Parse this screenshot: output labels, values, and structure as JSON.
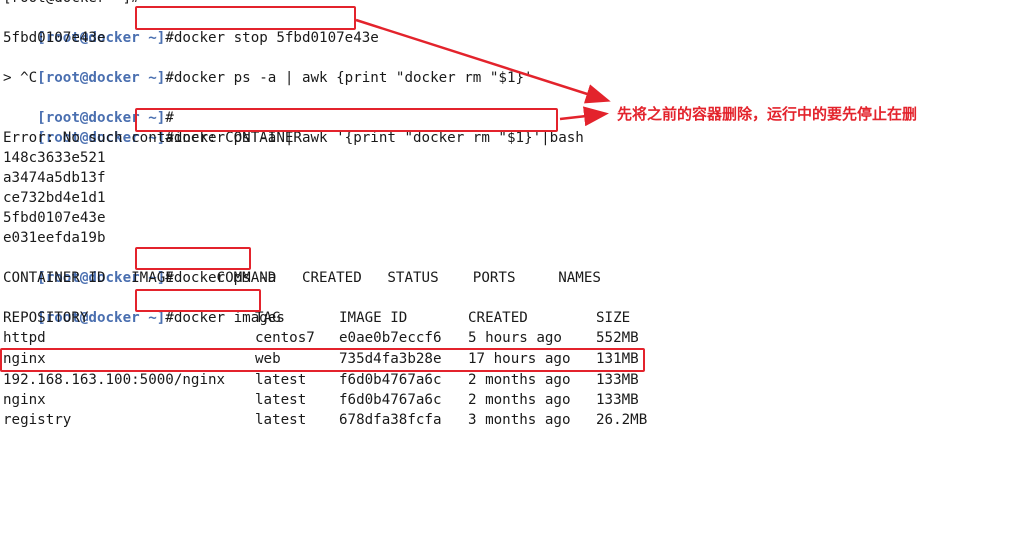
{
  "terminal": {
    "top_cut_fragment": "[root@docker ~]#",
    "lines": [
      {
        "type": "prompt",
        "prompt": "[root@docker ~]",
        "symbol": "#",
        "command": "docker stop 5fbd0107e43e"
      },
      {
        "type": "output",
        "text": "5fbd0107e43e"
      },
      {
        "type": "prompt",
        "prompt": "[root@docker ~]",
        "symbol": "#",
        "command": "docker ps -a | awk {print \"docker rm \"$1}'"
      },
      {
        "type": "output",
        "text": "> ^C"
      },
      {
        "type": "prompt",
        "prompt": "[root@docker ~]",
        "symbol": "#",
        "command": ""
      },
      {
        "type": "prompt",
        "prompt": "[root@docker ~]",
        "symbol": "#",
        "command": "docker ps -a | awk '{print \"docker rm \"$1}'|bash"
      },
      {
        "type": "output",
        "text": "Error: No such container: CONTAINER"
      },
      {
        "type": "output",
        "text": "148c3633e521"
      },
      {
        "type": "output",
        "text": "a3474a5db13f"
      },
      {
        "type": "output",
        "text": "ce732bd4e1d1"
      },
      {
        "type": "output",
        "text": "5fbd0107e43e"
      },
      {
        "type": "output",
        "text": "e031eefda19b"
      },
      {
        "type": "prompt",
        "prompt": "[root@docker ~]",
        "symbol": "#",
        "command": "docker ps -a"
      },
      {
        "type": "output",
        "text": "CONTAINER ID   IMAGE     COMMAND   CREATED   STATUS    PORTS     NAMES"
      },
      {
        "type": "prompt",
        "prompt": "[root@docker ~]",
        "symbol": "#",
        "command": "docker images"
      }
    ],
    "images_table": {
      "headers": [
        "REPOSITORY",
        "TAG",
        "IMAGE ID",
        "CREATED",
        "SIZE"
      ],
      "rows": [
        [
          "httpd",
          "centos7",
          "e0ae0b7eccf6",
          "5 hours ago",
          "552MB"
        ],
        [
          "nginx",
          "web",
          "735d4fa3b28e",
          "17 hours ago",
          "131MB"
        ],
        [
          "192.168.163.100:5000/nginx",
          "latest",
          "f6d0b4767a6c",
          "2 months ago",
          "133MB"
        ],
        [
          "nginx",
          "latest",
          "f6d0b4767a6c",
          "2 months ago",
          "133MB"
        ],
        [
          "registry",
          "latest",
          "678dfa38fcfa",
          "3 months ago",
          "26.2MB"
        ]
      ]
    }
  },
  "annotation": {
    "text": "先将之前的容器删除，运行中的要先停止在删"
  },
  "colors": {
    "prompt": "#4a6fb0",
    "text": "#1a1a1a",
    "highlight": "#e3232c",
    "background": "#ffffff"
  }
}
